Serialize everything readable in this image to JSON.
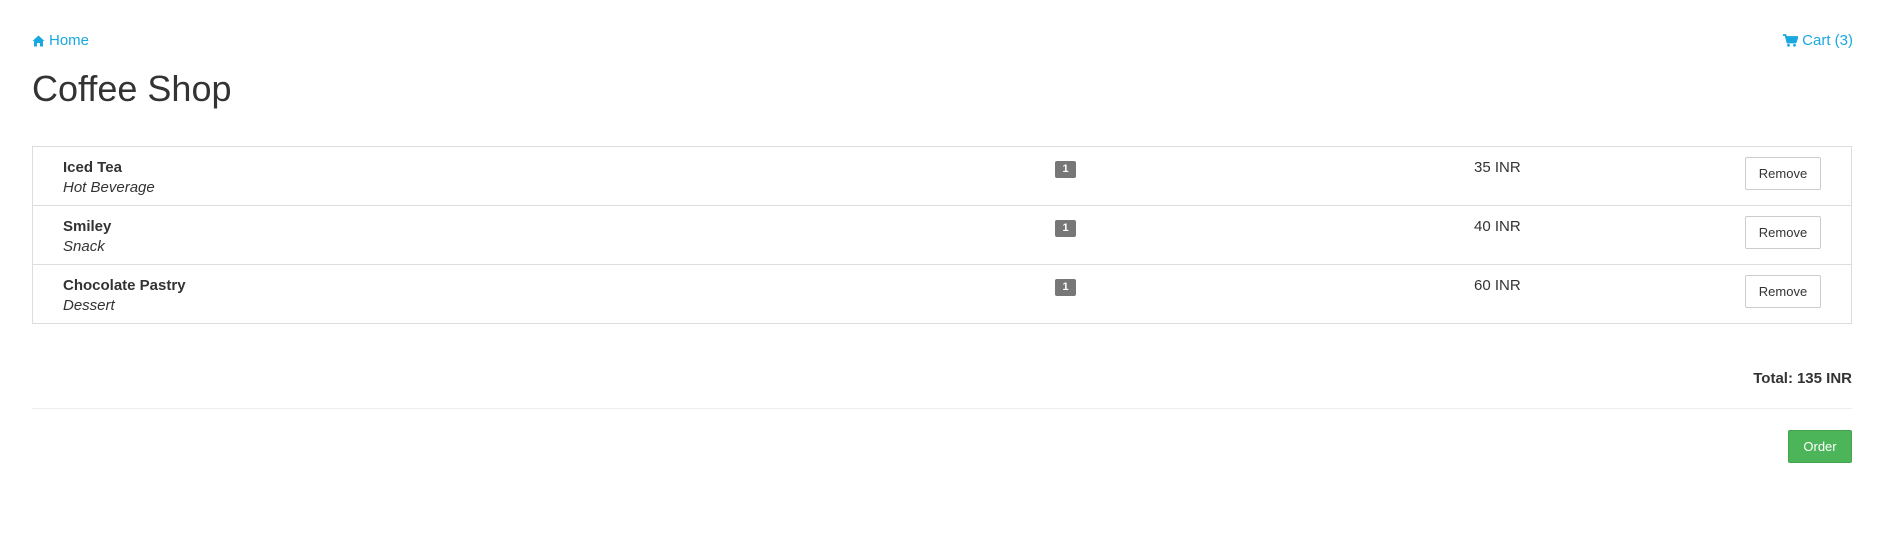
{
  "nav": {
    "home_label": "Home",
    "home_icon": "home-icon",
    "cart_label": "Cart (3)",
    "cart_icon": "shopping-cart-icon",
    "link_color": "#1aa8e0"
  },
  "page": {
    "title": "Coffee Shop"
  },
  "cart": {
    "items": [
      {
        "name": "Iced Tea",
        "category": "Hot Beverage",
        "quantity": "1",
        "price": "35 INR",
        "remove_label": "Remove"
      },
      {
        "name": "Smiley",
        "category": "Snack",
        "quantity": "1",
        "price": "40 INR",
        "remove_label": "Remove"
      },
      {
        "name": "Chocolate Pastry",
        "category": "Dessert",
        "quantity": "1",
        "price": "60 INR",
        "remove_label": "Remove"
      }
    ]
  },
  "summary": {
    "total_label": "Total:",
    "total_value": "135 INR"
  },
  "actions": {
    "order_label": "Order",
    "order_color": "#4cb55a"
  }
}
